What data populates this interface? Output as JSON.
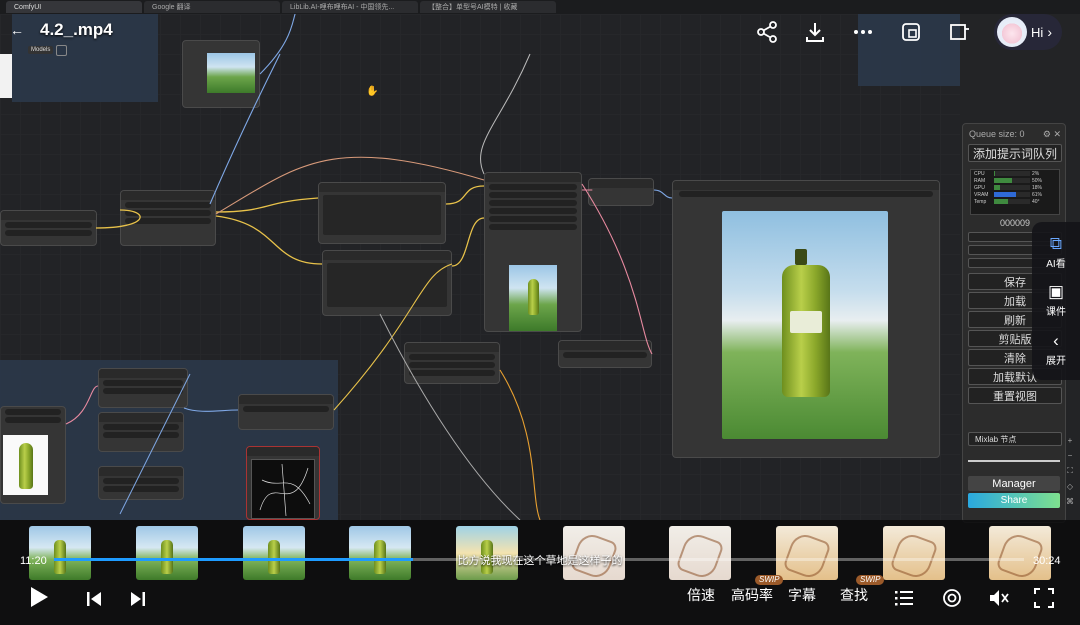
{
  "browser_tabs": [
    {
      "label": "ComfyUI",
      "active": true
    },
    {
      "label": "Google 翻译",
      "active": false
    },
    {
      "label": "LibLib.AI-哩布哩布AI - 中国领先...",
      "active": false
    },
    {
      "label": "【整合】单型号AI模特 | 收藏",
      "active": false
    }
  ],
  "video": {
    "title": "4.2_.mp4",
    "current_time": "11:20",
    "total_time": "30:24",
    "progress": 0.37,
    "subtitle": "比方说我现在这个草地是这样子的"
  },
  "top_icons": [
    "share-icon",
    "download-icon",
    "more-icon",
    "screen-cast-icon",
    "pip-icon"
  ],
  "assistant": {
    "label": "Hi",
    "chevron": "›"
  },
  "canvas": {
    "models_label": "Models"
  },
  "panel": {
    "queue_size": "Queue size: 0",
    "add_prompt": "添加提示词队列",
    "monitor": [
      {
        "label": "CPU",
        "value": "2%",
        "fill": 0.02
      },
      {
        "label": "RAM",
        "value": "50%",
        "fill": 0.5
      },
      {
        "label": "GPU",
        "value": "18%",
        "fill": 0.18
      },
      {
        "label": "VRAM",
        "value": "61%",
        "fill": 0.61
      },
      {
        "label": "Temp",
        "value": "40°",
        "fill": 0.4
      }
    ],
    "counter": "000009",
    "buttons": [
      "保存",
      "加载",
      "刷新",
      "剪贴版",
      "清除",
      "加载默认",
      "重置视图"
    ],
    "mixlab": "Mixlab 节点",
    "manager": "Manager",
    "share": "Share"
  },
  "side_float": [
    {
      "icon": "ai-view-icon",
      "label": "AI看"
    },
    {
      "icon": "courseware-icon",
      "label": "课件"
    },
    {
      "icon": "expand-icon",
      "label": "展开"
    }
  ],
  "controls": {
    "speed": "倍速",
    "quality": "高码率",
    "captions": "字幕",
    "search": "查找",
    "swip": "SWIP"
  },
  "colors": {
    "accent": "#1e9bff",
    "canvas_bg": "#222326",
    "group_bg": "#2c3a4c",
    "wire_yellow": "#e8c24a",
    "wire_blue": "#7fa8e6",
    "wire_pink": "#e88aa0"
  }
}
